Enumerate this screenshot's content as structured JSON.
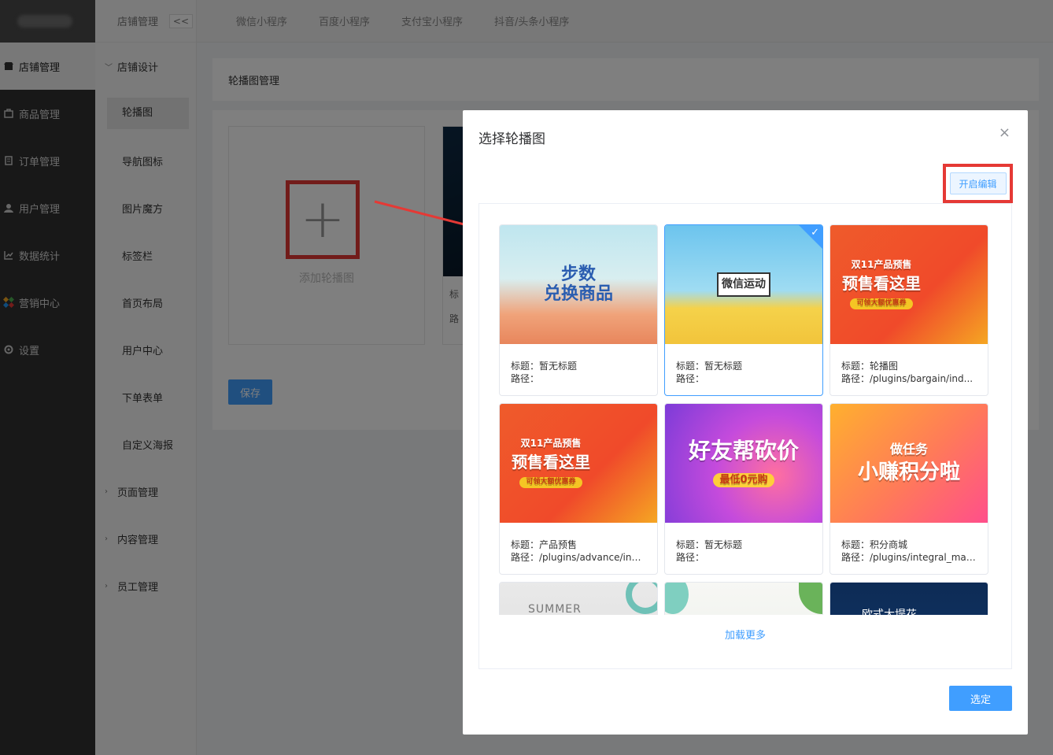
{
  "sidebar": {
    "items": [
      {
        "label": "店铺管理",
        "icon": "shop-icon"
      },
      {
        "label": "商品管理",
        "icon": "goods-icon"
      },
      {
        "label": "订单管理",
        "icon": "order-icon"
      },
      {
        "label": "用户管理",
        "icon": "user-icon"
      },
      {
        "label": "数据统计",
        "icon": "chart-icon"
      },
      {
        "label": "营销中心",
        "icon": "marketing-icon"
      },
      {
        "label": "设置",
        "icon": "settings-icon"
      }
    ]
  },
  "submenu": {
    "header": "店铺管理",
    "collapse": "<<",
    "group_open": "店铺设计",
    "leaves": [
      "轮播图",
      "导航图标",
      "图片魔方",
      "标签栏",
      "首页布局",
      "用户中心",
      "下单表单",
      "自定义海报"
    ],
    "groups_closed": [
      "页面管理",
      "内容管理",
      "员工管理"
    ]
  },
  "topbar": {
    "tabs": [
      "微信小程序",
      "百度小程序",
      "支付宝小程序",
      "抖音/头条小程序"
    ]
  },
  "main": {
    "breadcrumb": "轮播图管理",
    "add_label": "添加轮播图",
    "slide_title_prefix": "标",
    "slide_path_prefix": "路",
    "save": "保存"
  },
  "dialog": {
    "title": "选择轮播图",
    "close": "×",
    "edit_button": "开启编辑",
    "load_more": "加载更多",
    "confirm": "选定",
    "cards": [
      {
        "title": "标题：暂无标题",
        "path": "路径：",
        "art_line1": "步数",
        "art_line2": "兑换商品",
        "theme": "walk"
      },
      {
        "title": "标题：暂无标题",
        "path": "路径：",
        "art_line1": "微信运动",
        "art_line2": "",
        "theme": "run",
        "selected": true
      },
      {
        "title": "标题：轮播图",
        "path": "路径：/plugins/bargain/ind...",
        "art_line1": "双11产品预售",
        "art_line2": "预售看这里",
        "art_tag": "可领大额优惠券",
        "theme": "pre"
      },
      {
        "title": "标题：产品预售",
        "path": "路径：/plugins/advance/ind...",
        "art_line1": "双11产品预售",
        "art_line2": "预售看这里",
        "art_tag": "可领大额优惠券",
        "theme": "pre"
      },
      {
        "title": "标题：暂无标题",
        "path": "路径：",
        "art_line1": "好友帮砍价",
        "art_line2": "",
        "art_tag": "最低0元购",
        "theme": "kan"
      },
      {
        "title": "标题：积分商城",
        "path": "路径：/plugins/integral_mal...",
        "art_line1": "做任务",
        "art_line2": "小赚积分啦",
        "theme": "jf"
      },
      {
        "art_line1": "SUMMER",
        "theme": "sum"
      },
      {
        "art_line1": "",
        "theme": "lake"
      },
      {
        "art_line1": "欧式大堤花",
        "theme": "nav"
      }
    ]
  }
}
